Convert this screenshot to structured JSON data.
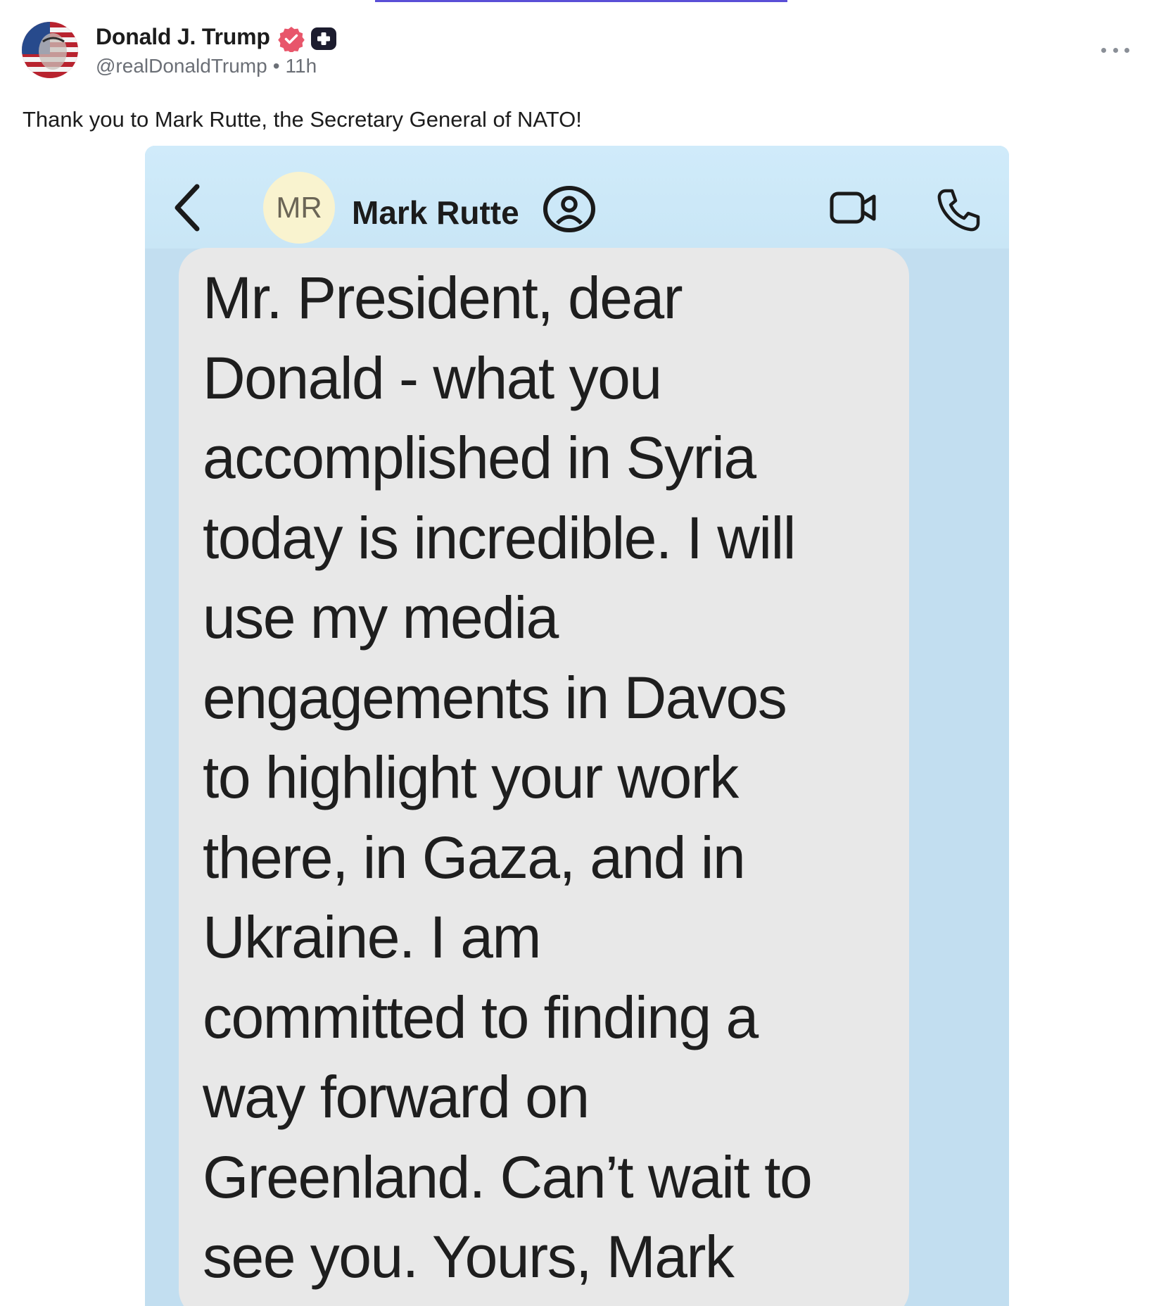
{
  "post": {
    "author_name": "Donald J. Trump",
    "handle": "@realDonaldTrump",
    "separator": "•",
    "time_ago": "11h",
    "text": "Thank you to Mark Rutte, the Secretary General of NATO!",
    "icons": [
      "avatar",
      "verified-badge-icon",
      "plus-badge-icon",
      "more-options-icon"
    ]
  },
  "media": {
    "contact_initials": "MR",
    "contact_name": "Mark Rutte",
    "message": "Mr. President, dear\nDonald - what you\naccomplished in Syria\ntoday is incredible. I will\nuse my media\nengagements in Davos\nto highlight your work\nthere, in Gaza, and in\nUkraine. I am\ncommitted to finding a\nway forward on\nGreenland. Can’t wait to\nsee you. Yours, Mark",
    "icons": [
      "back-icon",
      "contact-verified-icon",
      "video-call-icon",
      "phone-icon"
    ]
  },
  "colors": {
    "verified": "#e8566b",
    "accent": "#5a4fd6",
    "chat_background": "#c2def0",
    "bubble": "#e8e8e8"
  }
}
